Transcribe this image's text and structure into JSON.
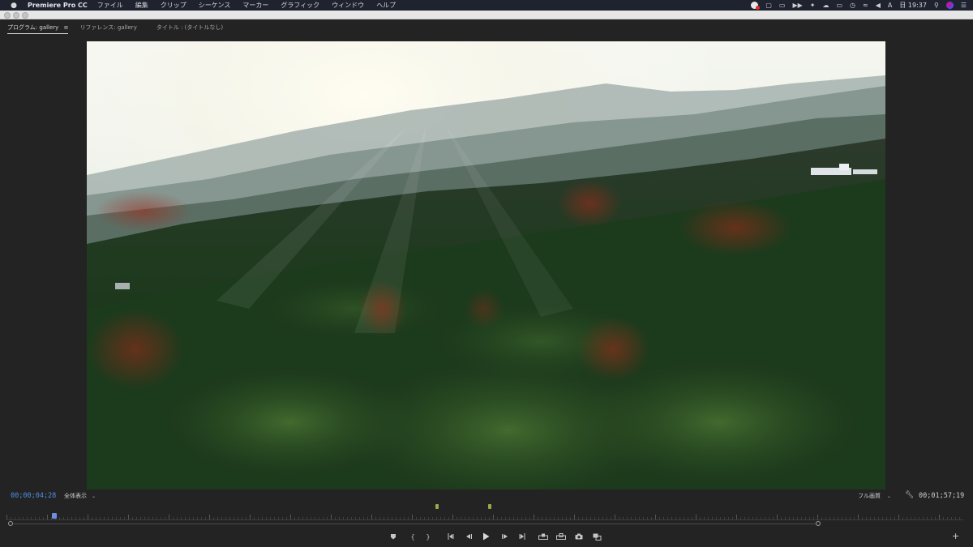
{
  "menubar": {
    "app_name": "Premiere Pro CC",
    "menus": [
      "ファイル",
      "編集",
      "クリップ",
      "シーケンス",
      "マーカー",
      "グラフィック",
      "ウィンドウ",
      "ヘルプ"
    ],
    "clock": "日 19:37",
    "status_icons": [
      "screen-record-icon",
      "display-icon",
      "airplay-icon",
      "media-forward-icon",
      "pin-icon",
      "cloud-icon",
      "battery-icon",
      "time-machine-icon",
      "wifi-icon",
      "volume-icon",
      "input-source-icon"
    ],
    "input_source": "A"
  },
  "panel": {
    "tabs": [
      {
        "label": "プログラム: gallery",
        "active": true
      },
      {
        "label": "リファレンス: gallery",
        "active": false
      },
      {
        "label": "タイトル : (タイトルなし)",
        "active": false
      }
    ],
    "menu_glyph": "≡"
  },
  "monitor": {
    "timecode_current": "00;00;04;28",
    "zoom_label": "全体表示",
    "quality_label": "フル画質",
    "timecode_duration": "00;01;57;19",
    "playhead_position": 0.05,
    "in_out_markers": [
      0.45,
      0.505
    ]
  },
  "transport": {
    "buttons": [
      "add-marker",
      "mark-in",
      "mark-out",
      "go-to-in",
      "step-back",
      "play",
      "step-forward",
      "go-to-out",
      "lift",
      "extract",
      "export-frame",
      "comparison-view"
    ],
    "mark_in_label": "{",
    "mark_out_label": "}",
    "add_label": "+"
  },
  "colors": {
    "accent_timecode": "#4f8fe6",
    "marker": "#9aa84a",
    "playhead": "#6d8fe0",
    "panel_bg": "#232323"
  }
}
